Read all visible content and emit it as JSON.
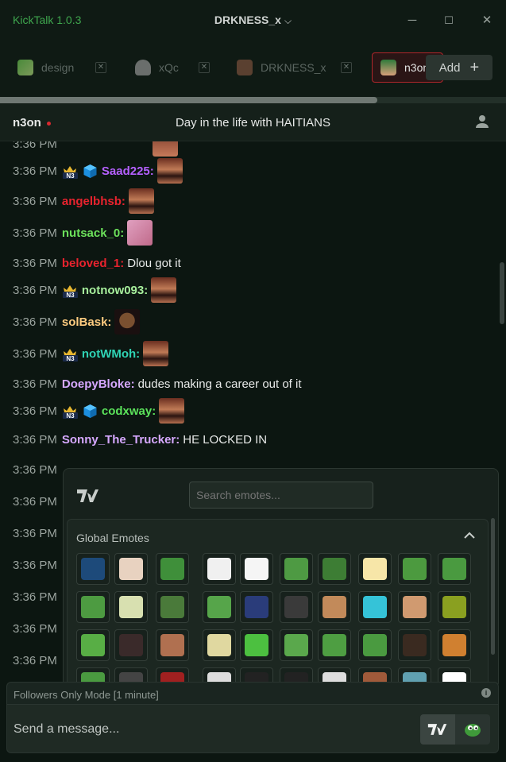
{
  "app": {
    "title": "KickTalk 1.0.3",
    "channel_title": "DRKNESS_x",
    "chevron": "chevron-down-icon"
  },
  "window": {
    "minimize": "─",
    "maximize": "☐",
    "close": "✕"
  },
  "tabs": [
    {
      "label": "design",
      "close": "✕",
      "active": false
    },
    {
      "label": "xQc",
      "close": "✕",
      "active": false
    },
    {
      "label": "DRKNESS_x",
      "close": "✕",
      "active": false
    },
    {
      "label": "n3on",
      "close": "",
      "active": true
    }
  ],
  "add_button": {
    "label": "Add",
    "icon": "+"
  },
  "chat_header": {
    "streamer": "n3on",
    "stream_title": "Day in the life with HAITIANS"
  },
  "messages": [
    {
      "time": "3:36 PM",
      "badges": [
        "n3",
        "cube"
      ],
      "user": "Saad225:",
      "color": "#b560ff",
      "text": "",
      "emote": "face"
    },
    {
      "time": "3:36 PM",
      "badges": [],
      "user": "angelbhsb:",
      "color": "#e8232e",
      "text": "",
      "emote": "face"
    },
    {
      "time": "3:36 PM",
      "badges": [],
      "user": "nutsack_0:",
      "color": "#6ce25b",
      "text": "",
      "emote": "pink"
    },
    {
      "time": "3:36 PM",
      "badges": [],
      "user": "beloved_1:",
      "color": "#e8232e",
      "text": "Dlou got it",
      "emote": ""
    },
    {
      "time": "3:36 PM",
      "badges": [
        "n3"
      ],
      "user": "notnow093:",
      "color": "#a7ef9c",
      "text": "",
      "emote": "face"
    },
    {
      "time": "3:36 PM",
      "badges": [],
      "user": "solBask:",
      "color": "#ffcc80",
      "text": "",
      "emote": "guy"
    },
    {
      "time": "3:36 PM",
      "badges": [
        "n3"
      ],
      "user": "notWMoh:",
      "color": "#2fd3b4",
      "text": "",
      "emote": "face"
    },
    {
      "time": "3:36 PM",
      "badges": [],
      "user": "DoepyBloke:",
      "color": "#d6a8ff",
      "text": "dudes making a career out of it",
      "emote": ""
    },
    {
      "time": "3:36 PM",
      "badges": [
        "n3",
        "cube"
      ],
      "user": "codxway:",
      "color": "#5be35b",
      "text": "",
      "emote": "face"
    },
    {
      "time": "3:36 PM",
      "badges": [],
      "user": "Sonny_The_Trucker:",
      "color": "#d6a8ff",
      "text": "HE LOCKED IN",
      "emote": ""
    }
  ],
  "partial_times": [
    "3:36 PM",
    "3:36 PM",
    "3:36 PM",
    "3:36 PM",
    "3:36 PM",
    "3:36 PM",
    "3:36 PM"
  ],
  "emote_picker": {
    "search_placeholder": "Search emotes...",
    "section_title": "Global Emotes",
    "collapse_icon": "chevron-up-icon"
  },
  "emote_colors": [
    [
      "#1d4a7a",
      "#e8d2c0",
      "#3f8f3a",
      "#f0f0f0",
      "#f5f5f5",
      "#4e9a43",
      "#3d7d34",
      "#f7e6a8",
      "#4c9a3f",
      "#4a9a40"
    ],
    [
      "#4d9b41",
      "#d8e0b0",
      "#4a7a3a",
      "#56a54a",
      "#2a3c7a",
      "#3a3a3a",
      "#c28a5a",
      "#35c3d8",
      "#d09a70",
      "#8aa020"
    ],
    [
      "#58ae45",
      "#3a2a2a",
      "#b07050",
      "#e0d8a0",
      "#4cc040",
      "#5aa84c",
      "#4e9e42",
      "#4a9a40",
      "#3a2a20",
      "#d08030"
    ],
    [
      "#4a9a40",
      "#444444",
      "#a02020",
      "#dddddd",
      "#222222",
      "#222222",
      "#dddddd",
      "#a05a3a",
      "#60a0b0",
      "#ffffff"
    ]
  ],
  "bottom": {
    "followers_only": "Followers Only Mode [1 minute]",
    "info_icon": "i",
    "message_placeholder": "Send a message..."
  }
}
